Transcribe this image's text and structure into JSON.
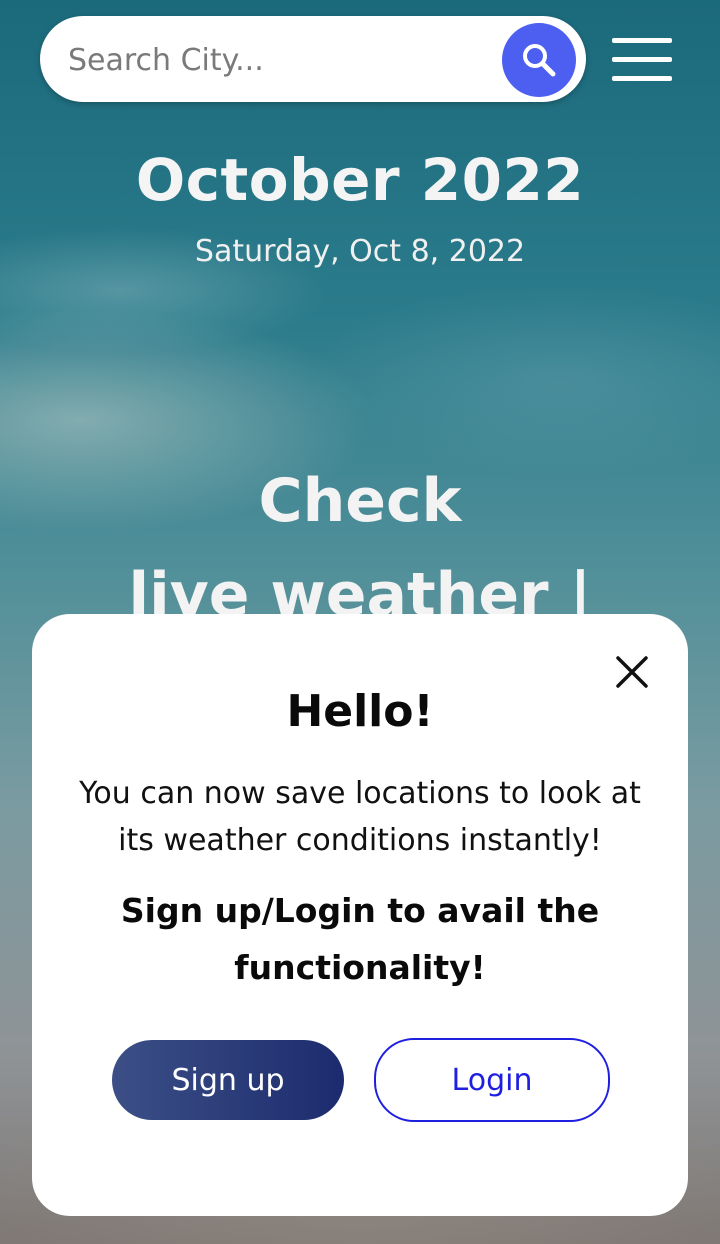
{
  "search": {
    "placeholder": "Search City...",
    "value": ""
  },
  "header": {
    "month_year": "October 2022",
    "full_date": "Saturday, Oct 8, 2022"
  },
  "hero": {
    "line1": "Check",
    "line2": "live weather |"
  },
  "modal": {
    "title": "Hello!",
    "body": "You can now save locations to look at its weather conditions instantly!",
    "cta": "Sign up/Login to avail the functionality!",
    "signup_label": "Sign up",
    "login_label": "Login"
  },
  "icons": {
    "search": "search-icon",
    "menu": "hamburger-menu-icon",
    "close": "close-icon"
  },
  "colors": {
    "search_button": "#4c5ff0",
    "signup_gradient_start": "#3c4f86",
    "signup_gradient_end": "#1c2b6e",
    "login_accent": "#1f1fe0"
  }
}
